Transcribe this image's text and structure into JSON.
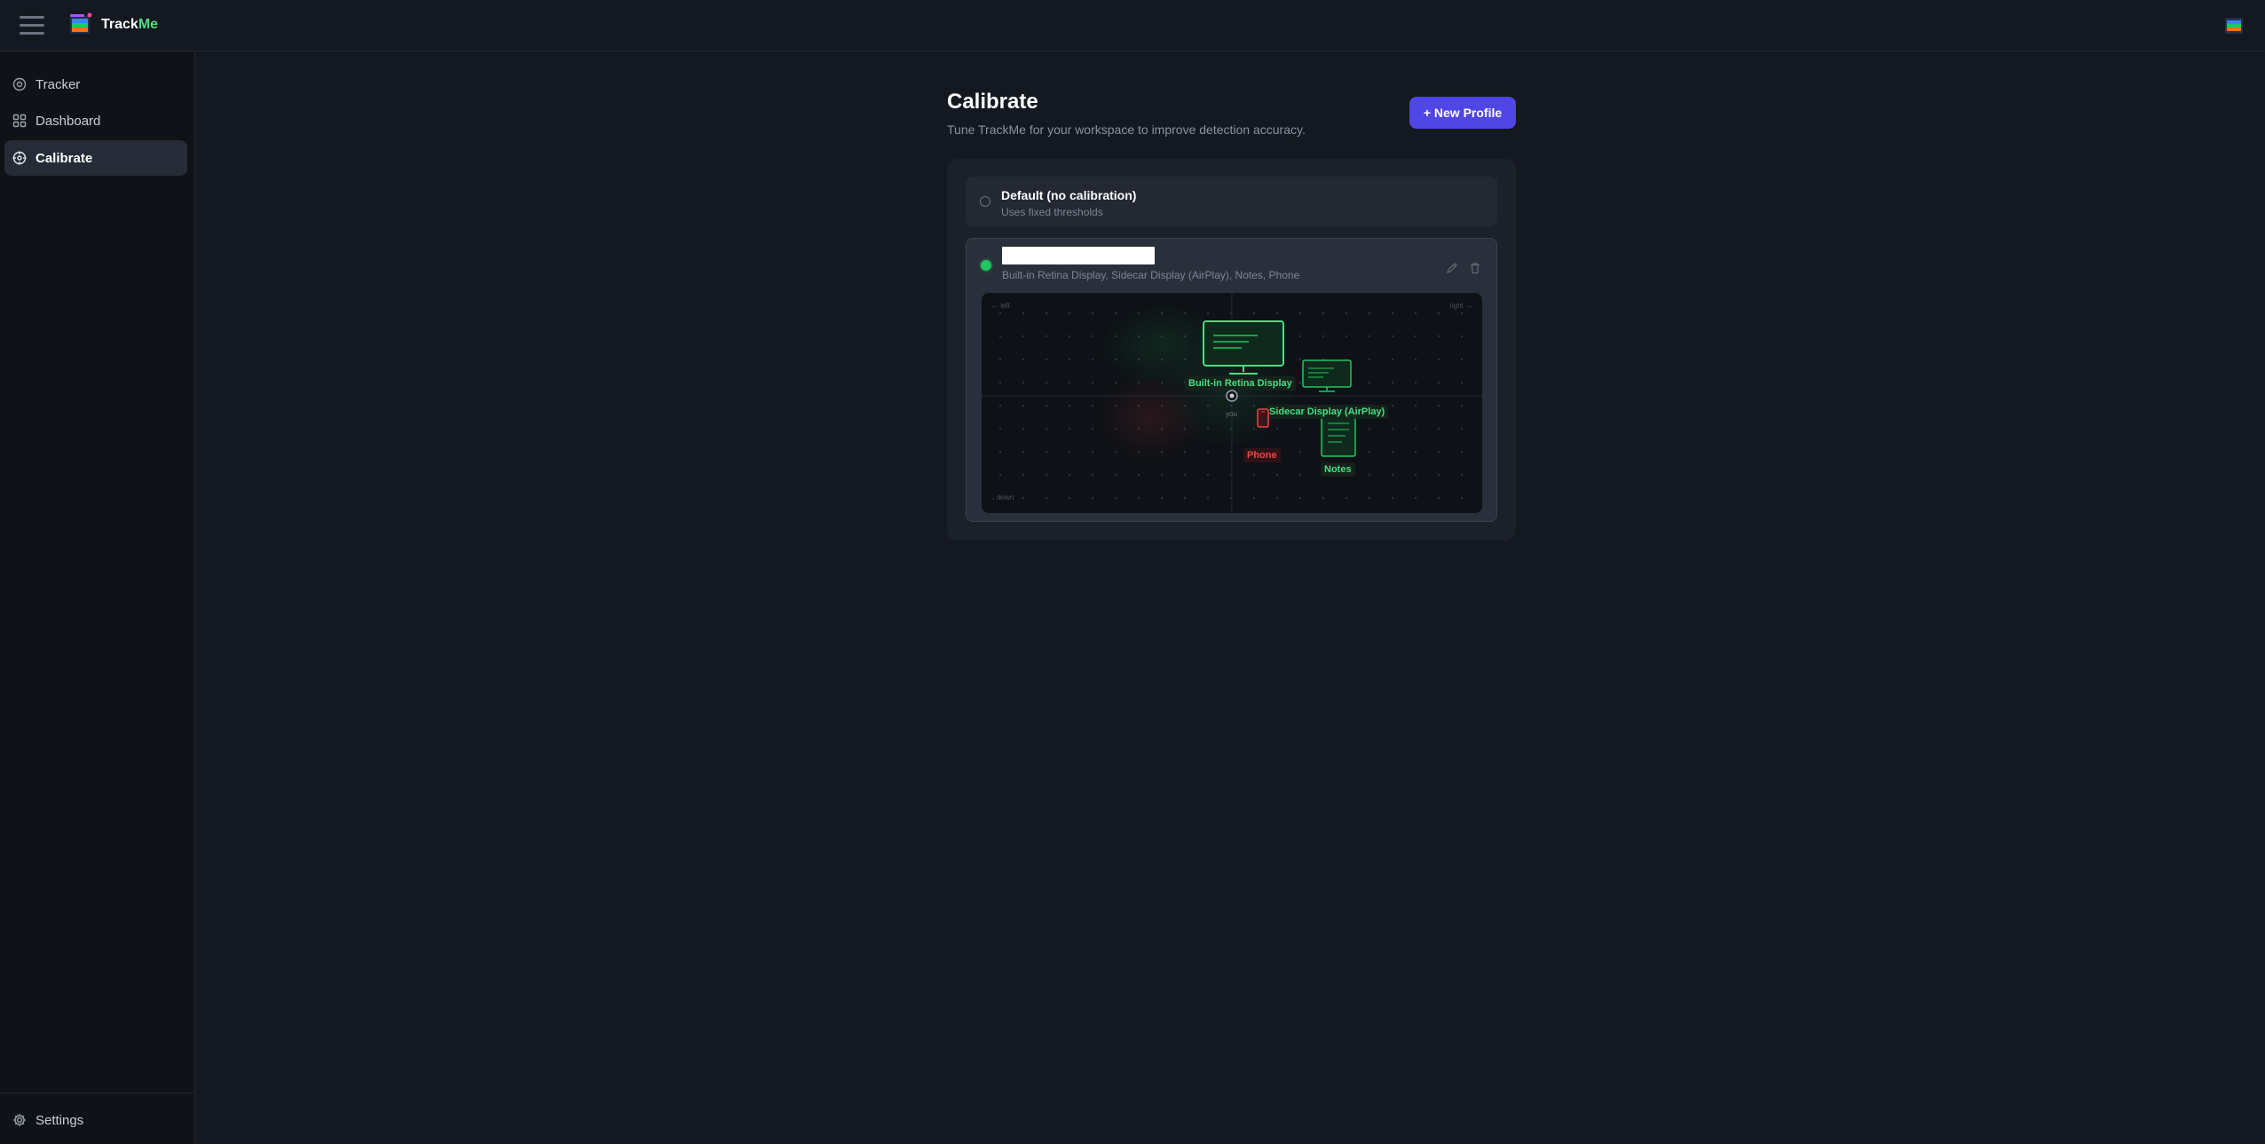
{
  "app": {
    "brand_prefix": "Track",
    "brand_suffix": "Me",
    "accent_color": "#4ade80",
    "primary_button_color": "#4f46e5"
  },
  "header": {
    "menu_icon": "hamburger-menu-icon",
    "logo_icon": "trackme-logo-icon",
    "avatar_icon": "user-avatar-icon"
  },
  "sidebar": {
    "items": [
      {
        "label": "Tracker",
        "icon": "target-icon",
        "active": false
      },
      {
        "label": "Dashboard",
        "icon": "grid-icon",
        "active": false
      },
      {
        "label": "Calibrate",
        "icon": "crosshair-icon",
        "active": true
      }
    ],
    "settings": {
      "label": "Settings",
      "icon": "gear-icon"
    }
  },
  "main": {
    "title": "Calibrate",
    "subtitle": "Tune TrackMe for your workspace to improve detection accuracy.",
    "new_profile_label": "+ New Profile",
    "profiles": [
      {
        "title": "Default (no calibration)",
        "subtitle": "Uses fixed thresholds",
        "selected": false
      },
      {
        "name_value": "",
        "subtitle": "Built-in Retina Display, Sidecar Display (AirPlay), Notes, Phone",
        "selected": true,
        "actions": [
          "edit-icon",
          "trash-icon"
        ]
      }
    ],
    "map": {
      "axis_left": "← left",
      "axis_right": "right →",
      "axis_down": "↓ down",
      "you_label": "you",
      "devices": [
        {
          "label": "Built-in Retina Display",
          "kind": "monitor",
          "status": "ok"
        },
        {
          "label": "Sidecar Display (AirPlay)",
          "kind": "monitor",
          "status": "ok"
        },
        {
          "label": "Notes",
          "kind": "document",
          "status": "ok"
        },
        {
          "label": "Phone",
          "kind": "phone",
          "status": "alert"
        }
      ]
    }
  }
}
